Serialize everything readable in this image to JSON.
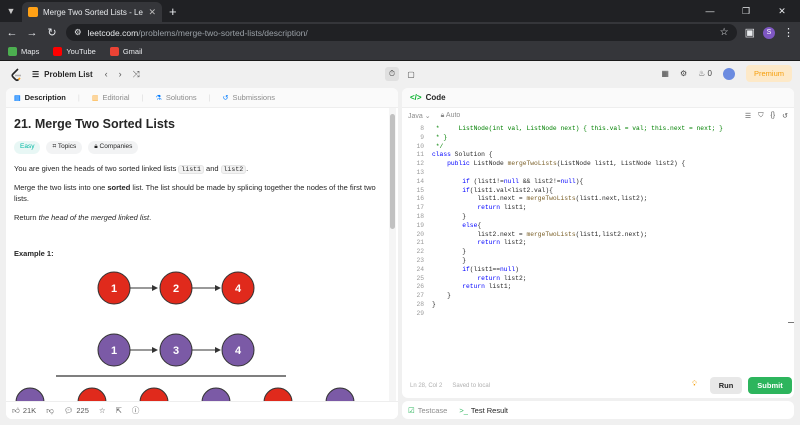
{
  "browser": {
    "tab_title": "Merge Two Sorted Lists - LeetC",
    "url_host": "leetcode.com",
    "url_path": "/problems/merge-two-sorted-lists/description/",
    "profile_initial": "S",
    "bookmarks": [
      {
        "label": "Maps",
        "color": "#4caf50"
      },
      {
        "label": "YouTube",
        "color": "#ff0000"
      },
      {
        "label": "Gmail",
        "color": "#ea4335"
      }
    ]
  },
  "header": {
    "problem_list": "Problem List",
    "streak": "0",
    "premium": "Premium"
  },
  "tabs": {
    "description": "Description",
    "editorial": "Editorial",
    "solutions": "Solutions",
    "submissions": "Submissions"
  },
  "problem": {
    "title": "21. Merge Two Sorted Lists",
    "difficulty": "Easy",
    "topics": "Topics",
    "companies": "Companies",
    "p1_before": "You are given the heads of two sorted linked lists ",
    "p1_code1": "list1",
    "p1_mid": " and ",
    "p1_code2": "list2",
    "p1_after": ".",
    "p2_before": "Merge the two lists into one ",
    "p2_bold": "sorted",
    "p2_after": " list. The list should be made by splicing together the nodes of the first two lists.",
    "p3_before": "Return ",
    "p3_italic": "the head of the merged linked list",
    "p3_after": ".",
    "example_label": "Example 1:",
    "list1_values": [
      "1",
      "2",
      "4"
    ],
    "list2_values": [
      "1",
      "3",
      "4"
    ],
    "list1_color": "#e02a1c",
    "list2_color": "#7b5aa6"
  },
  "footer": {
    "likes": "21K",
    "comments": "225"
  },
  "code": {
    "header": "Code",
    "language": "Java",
    "autosave": "Auto",
    "lines": [
      {
        "n": "8",
        "t": " *     ListNode(int val, ListNode next) { this.val = val; this.next = next; }",
        "cls": "c"
      },
      {
        "n": "9",
        "t": " * }",
        "cls": "c"
      },
      {
        "n": "10",
        "t": " */",
        "cls": "c"
      },
      {
        "n": "11",
        "t": "class Solution {",
        "cls": ""
      },
      {
        "n": "12",
        "t": "    public ListNode mergeTwoLists(ListNode list1, ListNode list2) {",
        "cls": ""
      },
      {
        "n": "13",
        "t": "",
        "cls": ""
      },
      {
        "n": "14",
        "t": "        if (list1!=null && list2!=null){",
        "cls": ""
      },
      {
        "n": "15",
        "t": "        if(list1.val<list2.val){",
        "cls": ""
      },
      {
        "n": "16",
        "t": "            list1.next = mergeTwoLists(list1.next,list2);",
        "cls": ""
      },
      {
        "n": "17",
        "t": "            return list1;",
        "cls": ""
      },
      {
        "n": "18",
        "t": "        }",
        "cls": ""
      },
      {
        "n": "19",
        "t": "        else{",
        "cls": ""
      },
      {
        "n": "20",
        "t": "            list2.next = mergeTwoLists(list1,list2.next);",
        "cls": ""
      },
      {
        "n": "21",
        "t": "            return list2;",
        "cls": ""
      },
      {
        "n": "22",
        "t": "        }",
        "cls": ""
      },
      {
        "n": "23",
        "t": "        }",
        "cls": ""
      },
      {
        "n": "24",
        "t": "        if(list1==null)",
        "cls": ""
      },
      {
        "n": "25",
        "t": "            return list2;",
        "cls": ""
      },
      {
        "n": "26",
        "t": "        return list1;",
        "cls": ""
      },
      {
        "n": "27",
        "t": "    }",
        "cls": ""
      },
      {
        "n": "28",
        "t": "}",
        "cls": ""
      },
      {
        "n": "29",
        "t": "",
        "cls": ""
      }
    ],
    "status": "Ln 28, Col 2",
    "saved": "Saved to local",
    "run": "Run",
    "submit": "Submit"
  },
  "bottom": {
    "testcase": "Testcase",
    "test_result": "Test Result"
  }
}
